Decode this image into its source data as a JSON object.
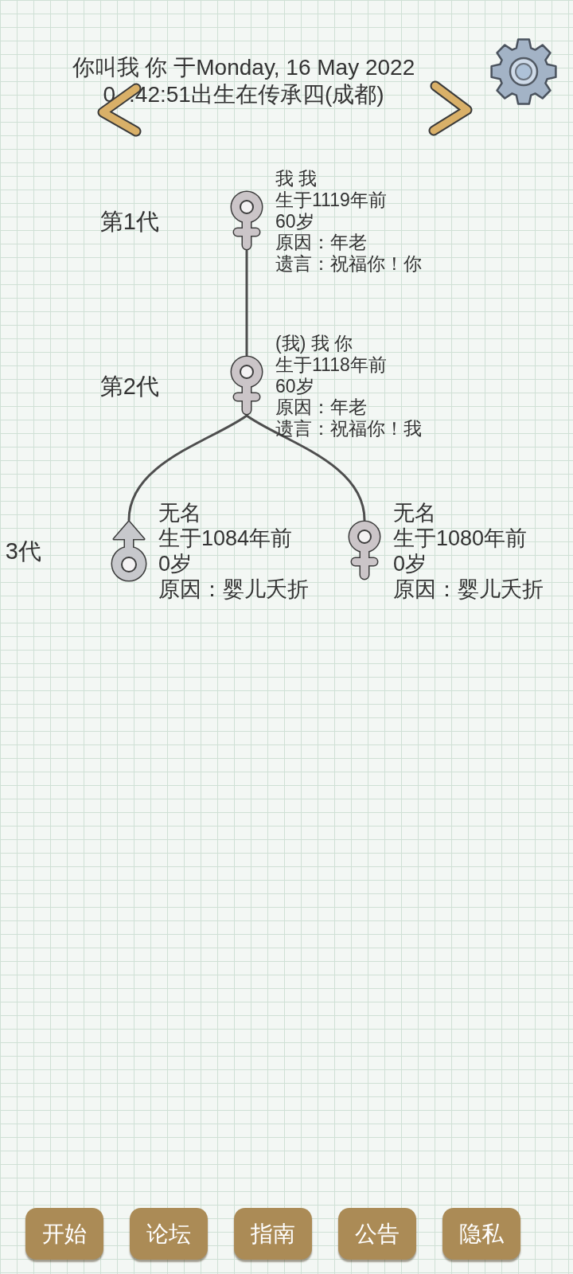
{
  "header": {
    "title_lines": [
      [
        "你叫我 你 于Monday, 16 May 2022"
      ],
      [
        "0",
        ".42:51出生在传承四(成都)"
      ]
    ]
  },
  "generation_labels": [
    "第1代",
    "第2代",
    "3代"
  ],
  "tree": {
    "kind": "female",
    "name": "我 我",
    "born": "生于1119年前",
    "age": "60岁",
    "cause": "原因：年老",
    "last_words": "遗言：祝福你！你",
    "children": [
      {
        "kind": "female",
        "name": "(我) 我 你",
        "born": "生于1118年前",
        "age": "60岁",
        "cause": "原因：年老",
        "last_words": "遗言：祝福你！我",
        "children": [
          {
            "kind": "male",
            "name": "无名",
            "born": "生于1084年前",
            "age": "0岁",
            "cause": "原因：婴儿夭折"
          },
          {
            "kind": "female",
            "name": "无名",
            "born": "生于1080年前",
            "age": "0岁",
            "cause": "原因：婴儿夭折"
          }
        ]
      }
    ]
  },
  "bottom_nav": [
    "开始",
    "论坛",
    "指南",
    "公告",
    "隐私"
  ]
}
